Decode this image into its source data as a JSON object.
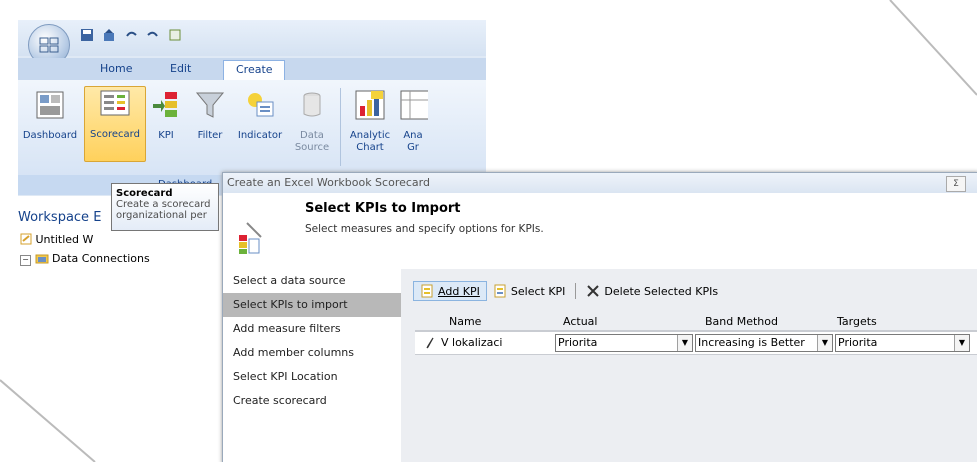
{
  "tabs": [
    {
      "label": "Home"
    },
    {
      "label": "Edit"
    },
    {
      "label": "Create"
    }
  ],
  "ribbon": {
    "buttons": [
      {
        "label": "Dashboard",
        "icon": "dashboard-icon"
      },
      {
        "label": "Scorecard",
        "icon": "scorecard-icon"
      },
      {
        "label": "KPI",
        "icon": "kpi-icon"
      },
      {
        "label": "Filter",
        "icon": "filter-icon"
      },
      {
        "label": "Indicator",
        "icon": "indicator-icon"
      },
      {
        "label_line1": "Data",
        "label_line2": "Source",
        "icon": "data-source-icon"
      },
      {
        "label_line1": "Analytic",
        "label_line2": "Chart",
        "icon": "analytic-chart-icon"
      },
      {
        "label_line1": "Ana",
        "label_line2": "Gr",
        "icon": "analytic-grid-icon"
      }
    ],
    "group_label": "Dashboard"
  },
  "workspace": {
    "title": "Workspace E",
    "tree": [
      {
        "label": "Untitled W"
      },
      {
        "label": "Data Connections"
      }
    ]
  },
  "tooltip": {
    "title": "Scorecard",
    "line1": "Create a scorecard",
    "line2": "organizational per"
  },
  "dialog": {
    "title": "Create an Excel Workbook Scorecard",
    "close_label": "Σ",
    "header_title": "Select KPIs to Import",
    "header_subtitle": "Select measures and specify options for KPIs.",
    "nav": [
      {
        "label": "Select a data source"
      },
      {
        "label": "Select KPIs to import"
      },
      {
        "label": "Add measure filters"
      },
      {
        "label": "Add member columns"
      },
      {
        "label": "Select KPI Location"
      },
      {
        "label": "Create scorecard"
      }
    ],
    "toolbar": {
      "add_kpi": "Add KPI",
      "select_kpi": "Select KPI",
      "delete_kpis": "Delete Selected KPIs"
    },
    "grid": {
      "columns": [
        "Name",
        "Actual",
        "Band Method",
        "Targets"
      ],
      "rows": [
        {
          "name": "V lokalizaci",
          "actual": "Priorita",
          "band_method": "Increasing is Better",
          "targets": "Priorita"
        }
      ]
    }
  },
  "colors": {
    "ribbon_text": "#15428b",
    "selected_button": "#ffd15c",
    "active_nav": "#b8b8b8"
  }
}
